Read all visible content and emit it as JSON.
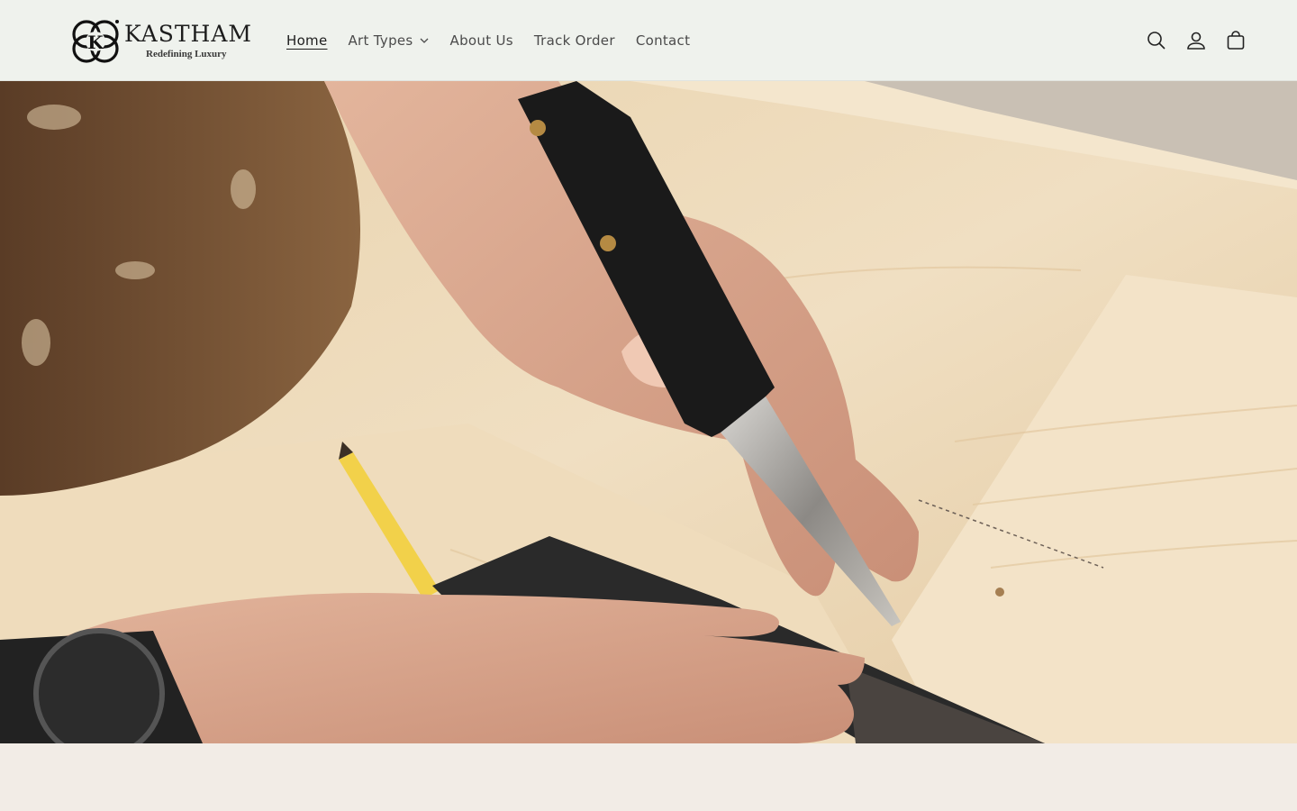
{
  "brand": {
    "name": "KASTHAM",
    "tagline": "Redefining Luxury"
  },
  "nav": {
    "items": [
      {
        "label": "Home",
        "active": true
      },
      {
        "label": "Art Types",
        "has_dropdown": true
      },
      {
        "label": "About Us"
      },
      {
        "label": "Track Order"
      },
      {
        "label": "Contact"
      }
    ]
  },
  "header_icons": [
    "search-icon",
    "account-icon",
    "cart-icon"
  ],
  "hero": {
    "image": "woodworker-marking-knife-on-wood"
  },
  "colors": {
    "header_bg": "#eff2ed",
    "page_bg": "#f2ece6",
    "text": "#1d1d1d"
  }
}
